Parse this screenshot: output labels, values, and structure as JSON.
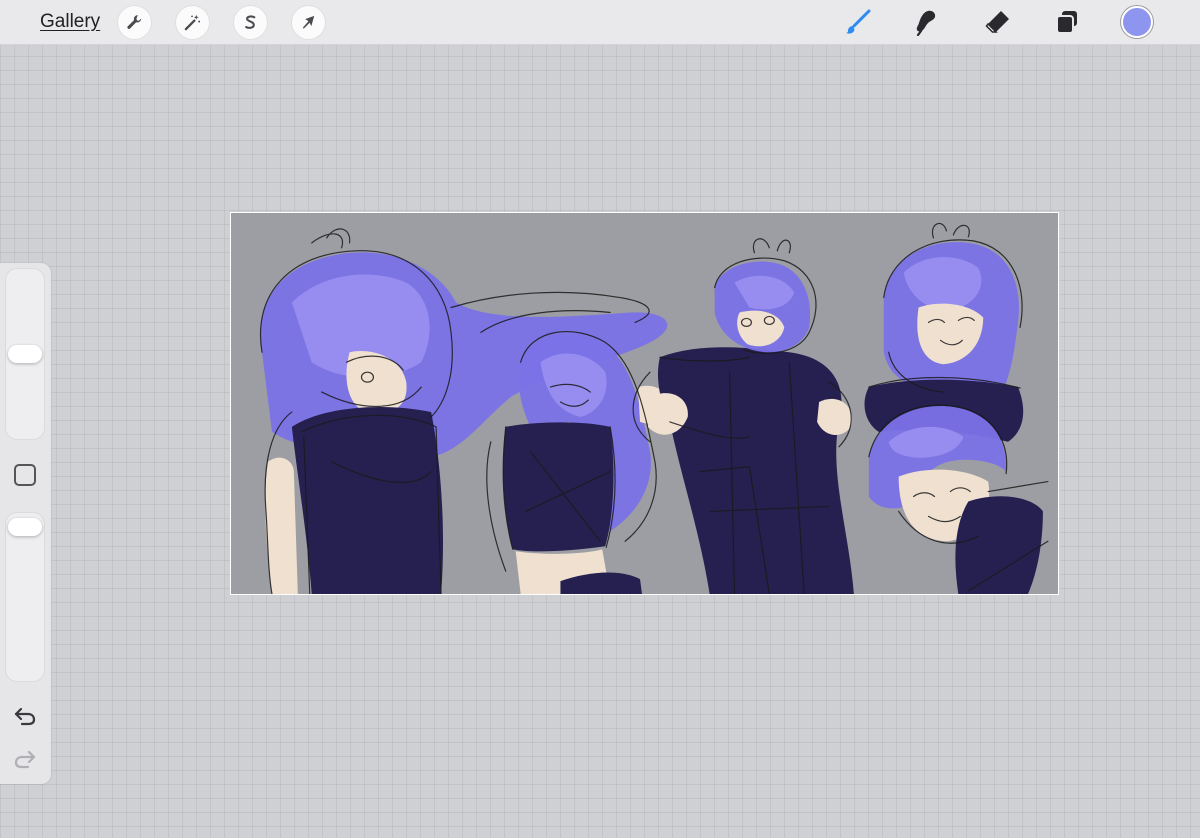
{
  "toolbar": {
    "gallery_label": "Gallery",
    "left_tools": [
      {
        "name": "actions",
        "icon": "wrench-icon"
      },
      {
        "name": "adjustments",
        "icon": "magic-wand-icon"
      },
      {
        "name": "selection",
        "icon": "selection-s-icon"
      },
      {
        "name": "transform",
        "icon": "arrow-cursor-icon"
      }
    ],
    "right_tools": [
      {
        "name": "brush",
        "icon": "brush-icon",
        "active": true
      },
      {
        "name": "smudge",
        "icon": "smudge-icon",
        "active": false
      },
      {
        "name": "eraser",
        "icon": "eraser-icon",
        "active": false
      },
      {
        "name": "layers",
        "icon": "layers-icon",
        "active": false
      }
    ],
    "current_color": "#8e95ee"
  },
  "sidebar": {
    "brush_size": 0.5,
    "brush_opacity": 1.0,
    "modify_icon": "square-icon",
    "undo_icon": "undo-icon",
    "redo_icon": "redo-icon"
  },
  "canvas": {
    "background": "#9d9ea3",
    "palette": {
      "hair": "#7b72e8",
      "hair_light": "#9a90f2",
      "clothing": "#262050",
      "skin": "#efe0d0",
      "line": "#1a1a1a"
    }
  }
}
